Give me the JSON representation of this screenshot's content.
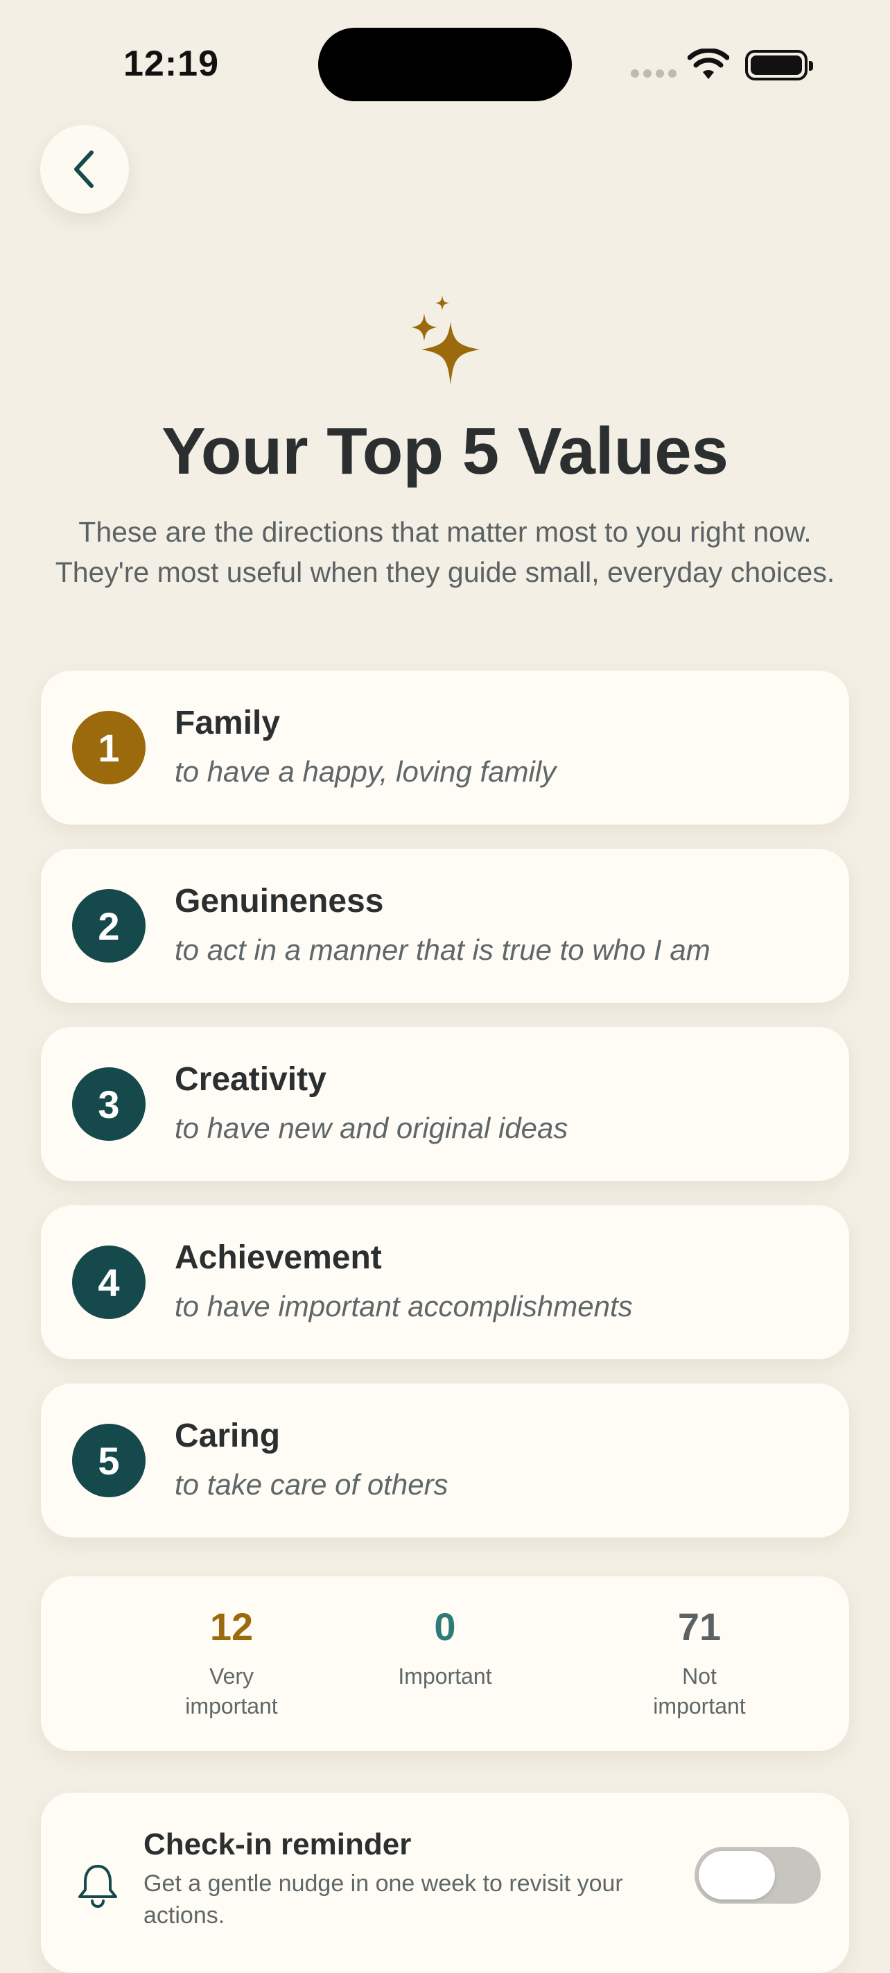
{
  "status_bar": {
    "time": "12:19"
  },
  "header": {
    "title": "Your Top 5 Values",
    "subtitle": "These are the directions that matter most to you right now. They're most useful when they guide small, everyday choices."
  },
  "values": [
    {
      "rank": "1",
      "name": "Family",
      "description": "to have a happy, loving family",
      "color": "#9a6a0c"
    },
    {
      "rank": "2",
      "name": "Genuineness",
      "description": "to act in a manner that is true to who I am",
      "color": "#15494c"
    },
    {
      "rank": "3",
      "name": "Creativity",
      "description": "to have new and original ideas",
      "color": "#15494c"
    },
    {
      "rank": "4",
      "name": "Achievement",
      "description": "to have important accomplishments",
      "color": "#15494c"
    },
    {
      "rank": "5",
      "name": "Caring",
      "description": "to take care of others",
      "color": "#15494c"
    }
  ],
  "stats": [
    {
      "count": "12",
      "label_line1": "Very",
      "label_line2": "important",
      "color": "#9a6a0c"
    },
    {
      "count": "0",
      "label_line1": "Important",
      "label_line2": "",
      "color": "#2d7a78"
    },
    {
      "count": "71",
      "label_line1": "Not",
      "label_line2": "important",
      "color": "#5a6264"
    }
  ],
  "reminder": {
    "title": "Check-in reminder",
    "description": "Get a gentle nudge in one week to revisit your actions.",
    "enabled": false
  },
  "icons": {
    "back": "chevron-left-icon",
    "sparkle": "sparkles-icon",
    "bell": "bell-icon"
  },
  "colors": {
    "background": "#f4efe4",
    "card": "#fefcf5",
    "accent_gold": "#9a6a0c",
    "accent_teal": "#15494c"
  }
}
